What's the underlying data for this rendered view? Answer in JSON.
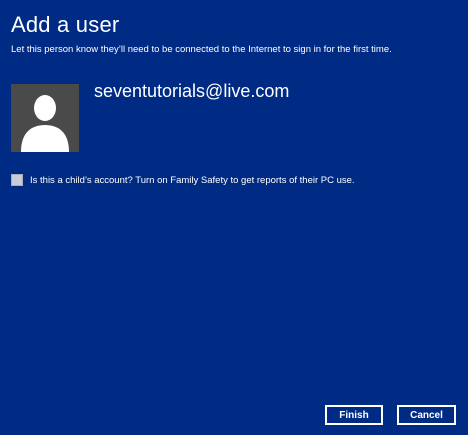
{
  "header": {
    "title": "Add a user",
    "subtitle": "Let this person know they’ll need to be connected to the Internet to sign in for the first time."
  },
  "account": {
    "email": "seventutorials@live.com",
    "avatar_icon": "user-silhouette-icon"
  },
  "family_safety": {
    "label": "Is this a child’s account? Turn on Family Safety to get reports of their PC use.",
    "checked": false
  },
  "actions": {
    "finish_label": "Finish",
    "cancel_label": "Cancel"
  },
  "colors": {
    "background": "#002b84",
    "text": "#ffffff",
    "avatar_background": "#4a4a4a",
    "checkbox_fill": "#c9ccd6"
  }
}
